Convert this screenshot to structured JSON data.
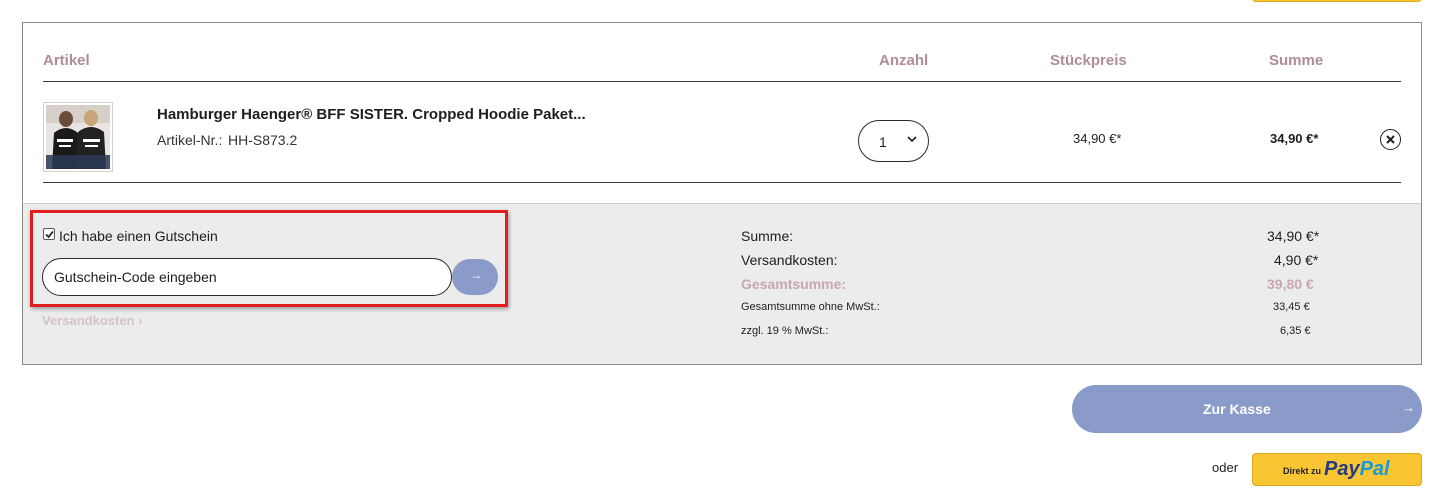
{
  "cart": {
    "columns": {
      "artikel": "Artikel",
      "anzahl": "Anzahl",
      "stueckpreis": "Stückpreis",
      "summe": "Summe"
    },
    "items": [
      {
        "name": "Hamburger Haenger® BFF SISTER. Cropped Hoodie Paket...",
        "article_no_label": "Artikel-Nr.:",
        "article_no": "HH-S873.2",
        "quantity": "1",
        "unit_price": "34,90 €*",
        "line_total": "34,90 €*",
        "image_icon": "product-photo-hoodies"
      }
    ]
  },
  "coupon": {
    "checked": true,
    "label": "Ich habe einen Gutschein",
    "input_placeholder": "Gutschein-Code eingeben",
    "submit_icon": "→"
  },
  "shipping_link": "Versandkosten",
  "shipping_link_icon": "›",
  "totals": {
    "summe_label": "Summe:",
    "summe_value": "34,90 €*",
    "versand_label": "Versandkosten:",
    "versand_value": "4,90 €*",
    "gesamt_label": "Gesamtsumme:",
    "gesamt_value": "39,80 €",
    "netto_label": "Gesamtsumme ohne MwSt.:",
    "netto_value": "33,45 €",
    "mwst_label": "zzgl. 19 % MwSt.:",
    "mwst_value": "6,35 €"
  },
  "checkout": {
    "label": "Zur Kasse",
    "arrow": "→"
  },
  "paypal": {
    "oder": "oder",
    "direkt": "Direkt zu",
    "logo_pay": "Pay",
    "logo_pal": "Pal"
  },
  "colors": {
    "accent_blue": "#8a9ac9",
    "header_mauve": "#b08d96",
    "highlight_red": "#e31d1d",
    "paypal_yellow": "#f9c532"
  }
}
